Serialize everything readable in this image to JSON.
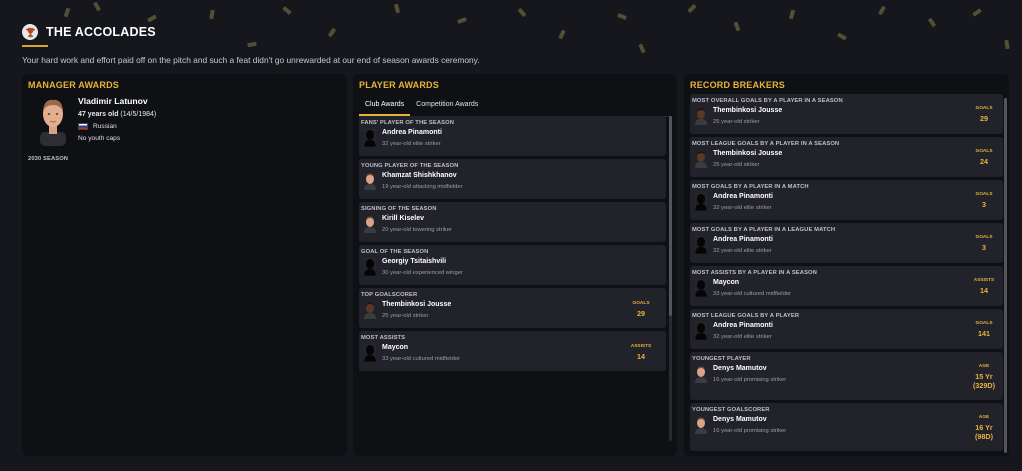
{
  "header": {
    "title": "THE ACCOLADES",
    "intro": "Your hard work and effort paid off on the pitch and such a feat didn't go unrewarded at our end of season awards ceremony."
  },
  "manager": {
    "panel_title": "MANAGER AWARDS",
    "name": "Vladimir Latunov",
    "age": "47 years old",
    "dob": "(14/5/1984)",
    "nationality": "Russian",
    "youth_caps": "No youth caps",
    "season": "2030 SEASON"
  },
  "player_awards": {
    "panel_title": "PLAYER AWARDS",
    "tabs": [
      "Club Awards",
      "Competition Awards"
    ],
    "items": [
      {
        "title": "FANS' PLAYER OF THE SEASON",
        "name": "Andrea Pinamonti",
        "desc": "32 year-old elite striker",
        "avatar": "silhouette"
      },
      {
        "title": "YOUNG PLAYER OF THE SEASON",
        "name": "Khamzat Shishkhanov",
        "desc": "19 year-old attacking midfielder",
        "avatar": "face"
      },
      {
        "title": "SIGNING OF THE SEASON",
        "name": "Kirill Kiselev",
        "desc": "20 year-old towering striker",
        "avatar": "face"
      },
      {
        "title": "GOAL OF THE SEASON",
        "name": "Georgiy Tsitaishvili",
        "desc": "30 year-old experienced winger",
        "avatar": "silhouette"
      },
      {
        "title": "TOP GOALSCORER",
        "name": "Thembinkosi Jousse",
        "desc": "25 year-old striker",
        "avatar": "face-dark",
        "stat_label": "GOALS",
        "stat_value": "29"
      },
      {
        "title": "MOST ASSISTS",
        "name": "Maycon",
        "desc": "33 year-old cultured midfielder",
        "avatar": "silhouette",
        "stat_label": "ASSISTS",
        "stat_value": "14"
      }
    ]
  },
  "records": {
    "panel_title": "RECORD BREAKERS",
    "items": [
      {
        "title": "MOST OVERALL GOALS BY A PLAYER IN A SEASON",
        "name": "Thembinkosi Jousse",
        "desc": "25 year-old striker",
        "avatar": "face-dark",
        "stat_label": "GOALS",
        "stat_value": "29"
      },
      {
        "title": "MOST LEAGUE GOALS BY A PLAYER IN A SEASON",
        "name": "Thembinkosi Jousse",
        "desc": "25 year-old striker",
        "avatar": "face-dark",
        "stat_label": "GOALS",
        "stat_value": "24"
      },
      {
        "title": "MOST GOALS BY A PLAYER IN A MATCH",
        "name": "Andrea Pinamonti",
        "desc": "32 year-old elite striker",
        "avatar": "silhouette",
        "stat_label": "GOALS",
        "stat_value": "3"
      },
      {
        "title": "MOST GOALS BY A PLAYER IN A LEAGUE MATCH",
        "name": "Andrea Pinamonti",
        "desc": "32 year-old elite striker",
        "avatar": "silhouette",
        "stat_label": "GOALS",
        "stat_value": "3"
      },
      {
        "title": "MOST ASSISTS BY A PLAYER IN A SEASON",
        "name": "Maycon",
        "desc": "33 year-old cultured midfielder",
        "avatar": "silhouette",
        "stat_label": "ASSISTS",
        "stat_value": "14"
      },
      {
        "title": "MOST LEAGUE GOALS BY A PLAYER",
        "name": "Andrea Pinamonti",
        "desc": "32 year-old elite striker",
        "avatar": "silhouette",
        "stat_label": "GOALS",
        "stat_value": "141"
      },
      {
        "title": "YOUNGEST PLAYER",
        "name": "Denys Mamutov",
        "desc": "16 year-old promising striker",
        "avatar": "face",
        "stat_label": "AGE",
        "stat_value": "15 Yr",
        "stat_value2": "(329D)"
      },
      {
        "title": "YOUNGEST GOALSCORER",
        "name": "Denys Mamutov",
        "desc": "16 year-old promising striker",
        "avatar": "face",
        "stat_label": "AGE",
        "stat_value": "16 Yr",
        "stat_value2": "(98D)"
      }
    ]
  },
  "colors": {
    "accent": "#e7b43a",
    "background": "#16171c",
    "panel": "#0f1014",
    "card": "#22232a"
  }
}
